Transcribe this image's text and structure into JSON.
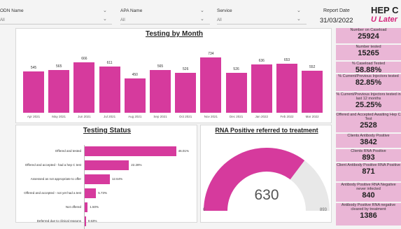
{
  "filters": [
    {
      "label": "ODN Name",
      "value": "All"
    },
    {
      "label": "APA Name",
      "value": "All"
    },
    {
      "label": "Service",
      "value": "All"
    }
  ],
  "report_date": {
    "label": "Report Date",
    "value": "31/03/2022"
  },
  "logo": {
    "line1": "HEP C",
    "line2": "U Later"
  },
  "testing_by_month": {
    "title": "Testing by Month",
    "chart_data": {
      "type": "bar",
      "categories": [
        "Apr 2021",
        "May 2021",
        "Jun 2021",
        "Jul 2021",
        "Aug 2021",
        "Sep 2021",
        "Oct 2021",
        "Nov 2021",
        "Dec 2021",
        "Jan 2022",
        "Feb 2022",
        "Mar 2022"
      ],
      "values": [
        545,
        565,
        666,
        611,
        450,
        565,
        526,
        734,
        526,
        636,
        653,
        552
      ],
      "ylim": [
        0,
        760
      ]
    }
  },
  "testing_status": {
    "title": "Testing Status",
    "chart_data": {
      "type": "bar",
      "orientation": "horizontal",
      "categories": [
        "Offered and tested",
        "Offered and accepted - had a hep C test",
        "Assessed as not appropriate to offer",
        "Offered and accepted - not yet had a test",
        "Not offered",
        "Deferred due to clinical reasons"
      ],
      "value_labels": [
        "46.01%",
        "22.28%",
        "12.64%",
        "5.73%",
        "1.50%",
        "0.63%"
      ],
      "values": [
        46.01,
        22.28,
        12.64,
        5.73,
        1.5,
        0.63
      ],
      "xlim": [
        0,
        50
      ]
    }
  },
  "rna_gauge": {
    "title": "RNA Positive referred to treatment",
    "value": 630,
    "min": 0,
    "max": 893,
    "value_label": "630",
    "min_label": "0",
    "max_label": "893"
  },
  "kpis": [
    {
      "label": "Number on Caseload",
      "value": "25924"
    },
    {
      "label": "Number tested",
      "value": "15265"
    },
    {
      "label": "% Caseload Tested",
      "value": "58.88%"
    },
    {
      "label": "% Current/Previous Injectors tested",
      "value": "82.85%"
    },
    {
      "label": "% Current/Previous Injectors tested in last 12 months",
      "value": "25.25%"
    },
    {
      "label": "Offered and Accepted Awaiting Hep C Test",
      "value": "2528"
    },
    {
      "label": "Clients Antibody Positive",
      "value": "3842"
    },
    {
      "label": "Clients RNA Positive",
      "value": "893"
    },
    {
      "label": "Client Antibody Positive RNA Positive",
      "value": "871"
    },
    {
      "label": "Antibody Positive RNA Negative never infected",
      "value": "840"
    },
    {
      "label": "Antibody Positive RNA negative cleared by treatment",
      "value": "1386"
    }
  ],
  "colors": {
    "accent": "#d63a9d",
    "kpi_bg": "#eab6d6",
    "gauge_track": "#e8e8e8",
    "logo": "#d4237a"
  }
}
